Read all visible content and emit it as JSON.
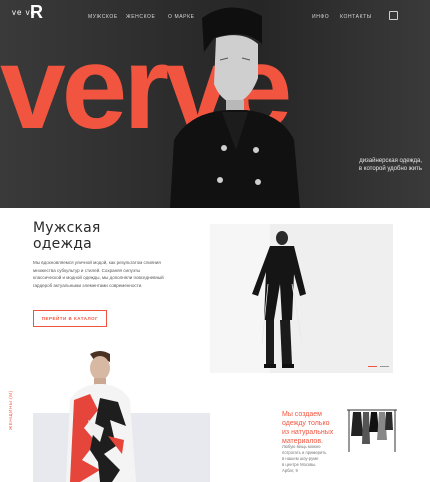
{
  "logo": {
    "small": "ve ve",
    "big": "R"
  },
  "nav": {
    "items": [
      "МУЖСКОЕ",
      "ЖЕНСКОЕ",
      "О МАРКЕ",
      "ИНФО",
      "КОНТАКТЫ"
    ]
  },
  "hero": {
    "word": "verve",
    "tagline_line1": "дизайнерская одежда,",
    "tagline_line2": "в которой удобно жить"
  },
  "men": {
    "title_line1": "Мужская",
    "title_line2": "одежда",
    "intro": "Мы вдохновляемся уличной модой, как результатом слияния множества субкультур и стилей. Сохраняя силуэты классической и модной одежды, мы дополняли повседневный гардероб актуальными элементами современности.",
    "cta": "ПЕРЕЙТИ В КАТАЛОГ"
  },
  "women": {
    "vertical": "ЖЕНЩИНЫ (М)",
    "headline_line1": "Мы создаем",
    "headline_line2": "одежду только",
    "headline_line3": "из натуральных",
    "headline_line4": "материалов.",
    "small_line1": "Любую вещь можно",
    "small_line2": "потрогать и примерить",
    "small_line3": "в нашем шоу-руме",
    "small_line4": "в центре Москвы.",
    "small_line5": "Арбат, 9"
  },
  "colors": {
    "accent": "#f2553f",
    "dark": "#2a2a2a"
  },
  "icons": {
    "cart": "bag-icon",
    "arrow_left": "arrow-left-icon",
    "arrow_right": "arrow-right-icon"
  }
}
